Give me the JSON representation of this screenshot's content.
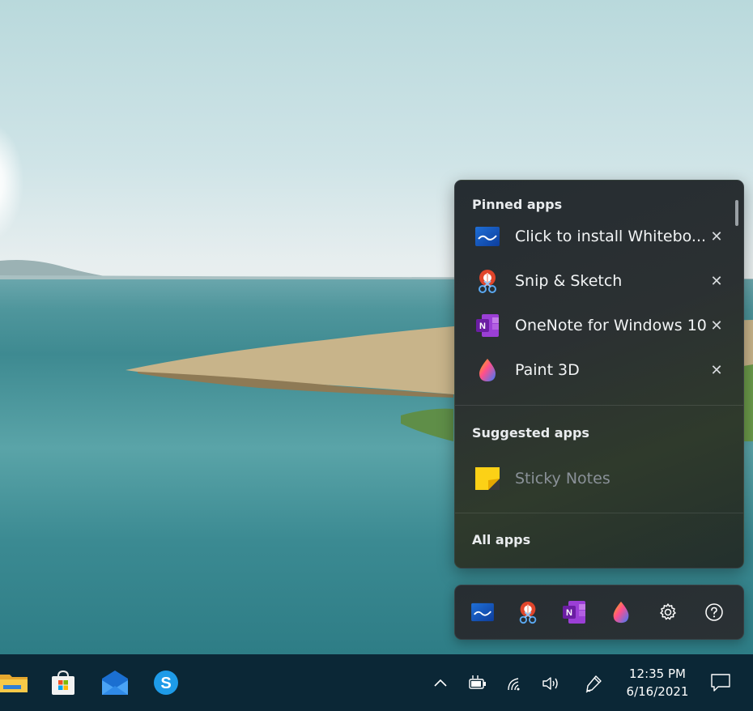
{
  "flyout": {
    "pinned_title": "Pinned apps",
    "pinned": [
      {
        "label": "Click to install Whitebo...",
        "icon": "whiteboard-icon"
      },
      {
        "label": "Snip & Sketch",
        "icon": "snip-sketch-icon"
      },
      {
        "label": "OneNote for Windows 10",
        "icon": "onenote-icon"
      },
      {
        "label": "Paint 3D",
        "icon": "paint3d-icon"
      }
    ],
    "close_glyph": "✕",
    "suggested_title": "Suggested apps",
    "suggested": [
      {
        "label": "Sticky Notes",
        "icon": "sticky-notes-icon"
      }
    ],
    "all_apps_label": "All apps"
  },
  "quickbar": {
    "items": [
      "whiteboard-icon",
      "snip-sketch-icon",
      "onenote-icon",
      "paint3d-icon",
      "gear-icon",
      "help-icon"
    ]
  },
  "taskbar": {
    "pinned": [
      "file-explorer-icon",
      "microsoft-store-icon",
      "mail-icon",
      "skype-icon"
    ],
    "tray": [
      "chevron-up-icon",
      "battery-icon",
      "wifi-icon",
      "volume-icon",
      "pen-icon"
    ],
    "time": "12:35 PM",
    "date": "6/16/2021",
    "notification_icon": "notification-icon"
  },
  "colors": {
    "taskbar": "#0b2736",
    "flyout_bg": "#2b3032",
    "onenote_purple": "#7719aa",
    "sticky_yellow": "#fcd116"
  }
}
